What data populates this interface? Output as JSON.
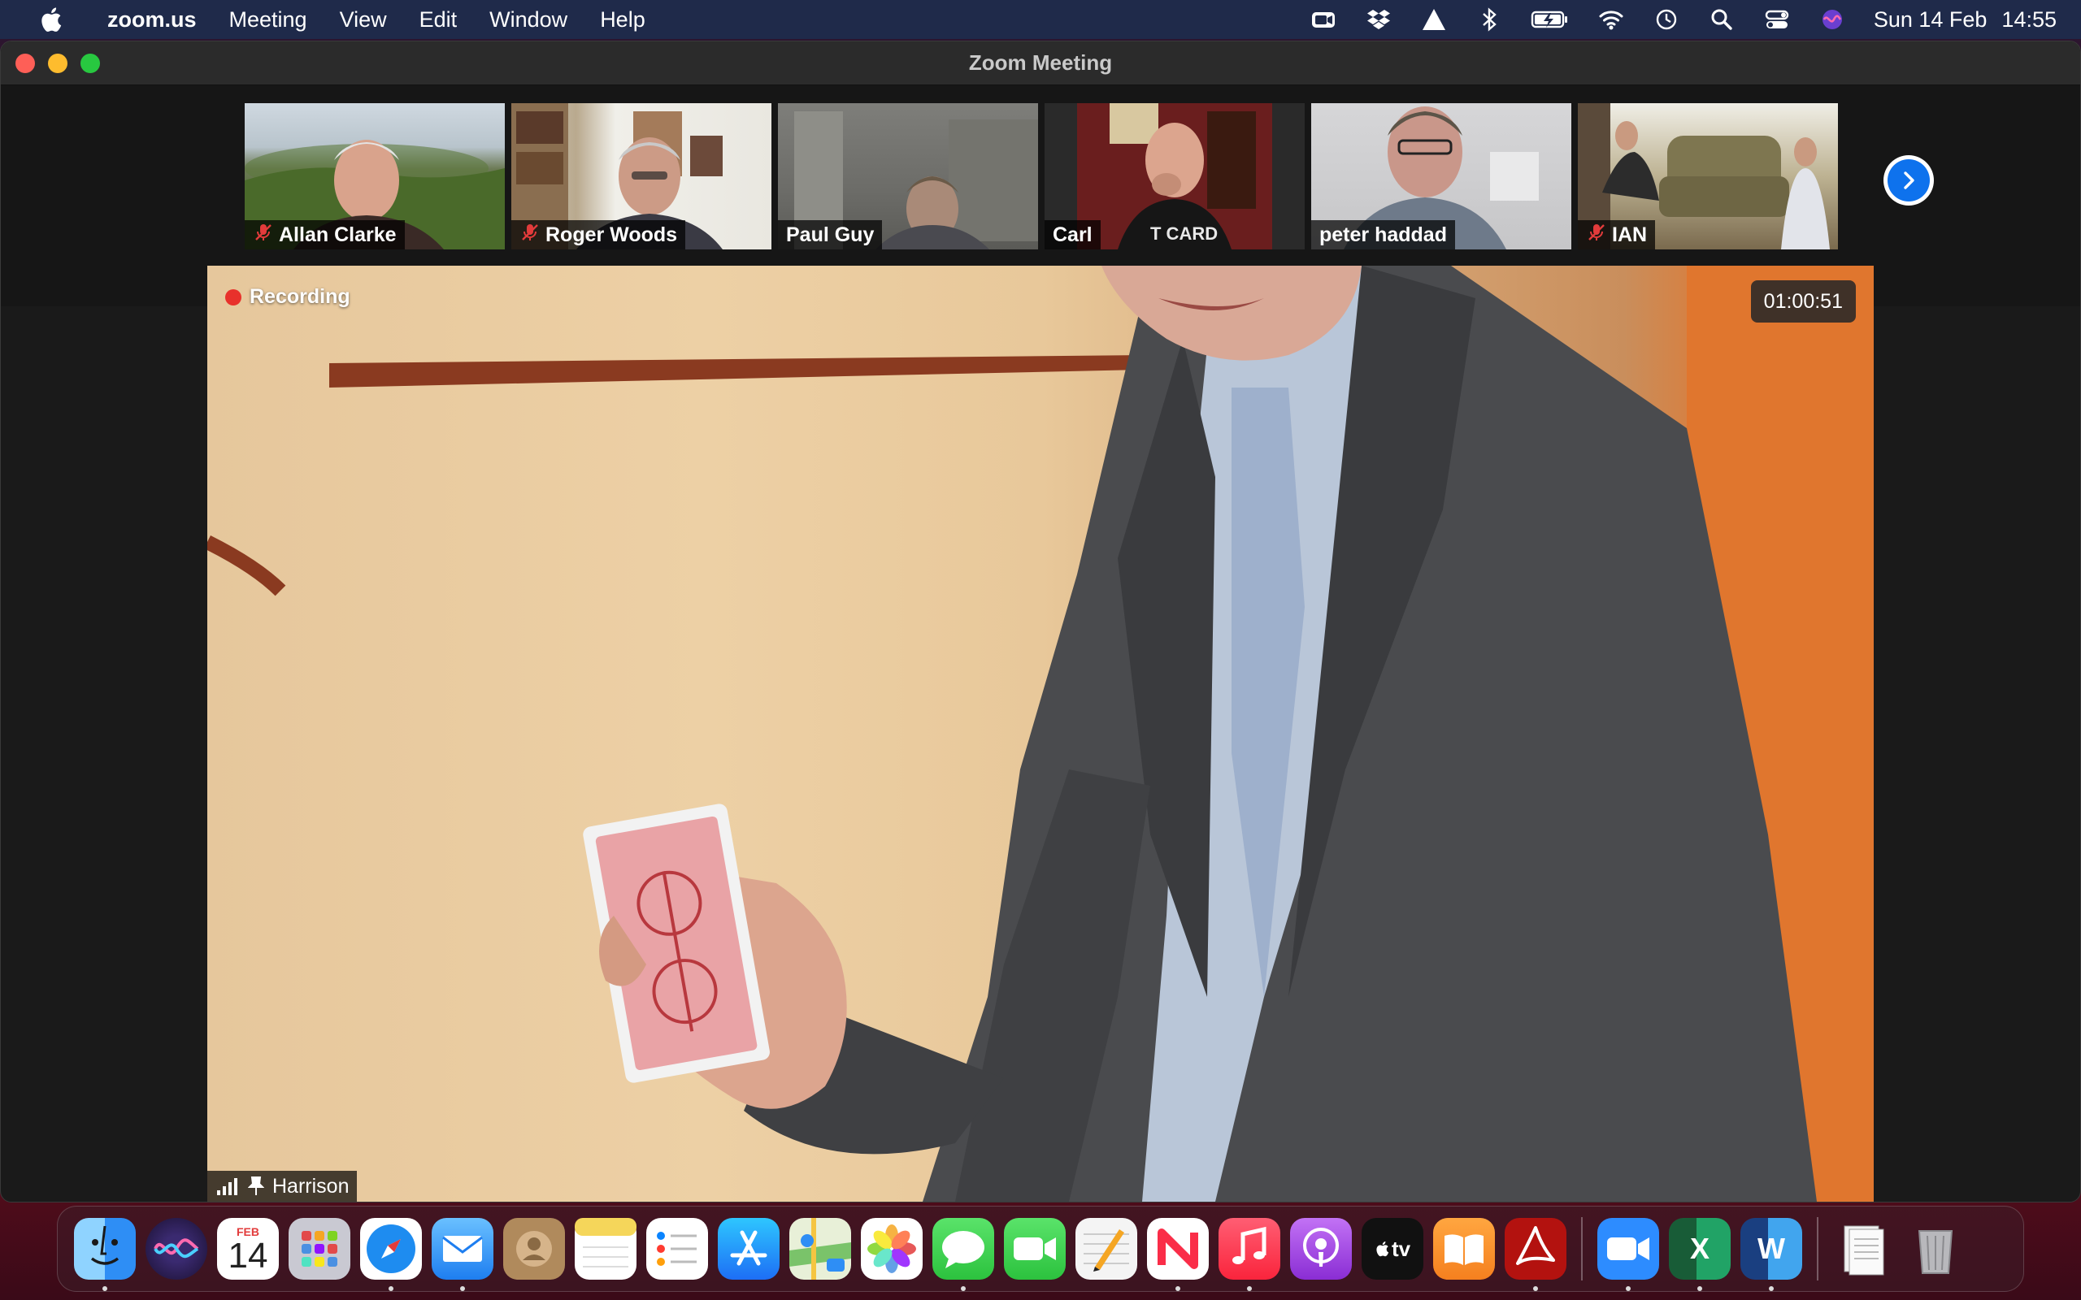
{
  "menubar": {
    "app_name": "zoom.us",
    "menus": [
      "Meeting",
      "View",
      "Edit",
      "Window",
      "Help"
    ],
    "date": "Sun 14 Feb",
    "time": "14:55",
    "status_icons": [
      "zoom-icon",
      "dropbox-icon",
      "drive-icon",
      "bluetooth-icon",
      "battery-icon",
      "wifi-icon",
      "time-machine-icon",
      "spotlight-search-icon",
      "control-center-icon",
      "siri-icon"
    ]
  },
  "window": {
    "title": "Zoom Meeting"
  },
  "participants": [
    {
      "name": "Allan Clarke",
      "muted": true
    },
    {
      "name": "Roger Woods",
      "muted": true
    },
    {
      "name": "Paul Guy",
      "muted": false
    },
    {
      "name": "Carl",
      "muted": false
    },
    {
      "name": "peter haddad",
      "muted": false
    },
    {
      "name": "IAN",
      "muted": true
    }
  ],
  "main_video": {
    "recording_label": "Recording",
    "elapsed": "01:00:51",
    "speaker_name": "Harrison"
  },
  "dock": {
    "apps": [
      {
        "name": "Finder",
        "icon": "finder-icon",
        "color": "#3a9cf0",
        "running": true
      },
      {
        "name": "Siri",
        "icon": "siri-icon",
        "color": "#5a3cc8",
        "running": false
      },
      {
        "name": "Calendar",
        "icon": "calendar-icon",
        "color": "#ffffff",
        "running": false,
        "month": "FEB",
        "day": "14"
      },
      {
        "name": "Launchpad",
        "icon": "launchpad-icon",
        "color": "#c9c9d2",
        "running": false
      },
      {
        "name": "Safari",
        "icon": "safari-icon",
        "color": "#1e8cf0",
        "running": true
      },
      {
        "name": "Mail",
        "icon": "mail-icon",
        "color": "#2e8ef5",
        "running": true
      },
      {
        "name": "Contacts",
        "icon": "contacts-icon",
        "color": "#b08a5c",
        "running": false
      },
      {
        "name": "Notes",
        "icon": "notes-icon",
        "color": "#f5d65a",
        "running": false
      },
      {
        "name": "Reminders",
        "icon": "reminders-icon",
        "color": "#ffffff",
        "running": false
      },
      {
        "name": "App Store",
        "icon": "app-store-icon",
        "color": "#1d8cf5",
        "running": false
      },
      {
        "name": "Maps",
        "icon": "maps-icon",
        "color": "#7ac36a",
        "running": false
      },
      {
        "name": "Photos",
        "icon": "photos-icon",
        "color": "#ffffff",
        "running": false
      },
      {
        "name": "Messages",
        "icon": "messages-icon",
        "color": "#3ccf4e",
        "running": true
      },
      {
        "name": "FaceTime",
        "icon": "facetime-icon",
        "color": "#3ccf4e",
        "running": false
      },
      {
        "name": "Pages",
        "icon": "pages-icon",
        "color": "#f4f4f4",
        "running": false
      },
      {
        "name": "News",
        "icon": "news-icon",
        "color": "#ffffff",
        "running": true
      },
      {
        "name": "Music",
        "icon": "music-icon",
        "color": "#fa3c55",
        "running": true
      },
      {
        "name": "Podcasts",
        "icon": "podcasts-icon",
        "color": "#a24ad9",
        "running": false
      },
      {
        "name": "TV",
        "icon": "tv-icon",
        "color": "#1a1a1a",
        "running": false
      },
      {
        "name": "Books",
        "icon": "books-icon",
        "color": "#f58a1f",
        "running": false
      },
      {
        "name": "Acrobat",
        "icon": "acrobat-icon",
        "color": "#b3120f",
        "running": true
      }
    ],
    "apps_right": [
      {
        "name": "Zoom",
        "icon": "zoom-app-icon",
        "color": "#2d8cff",
        "running": true
      },
      {
        "name": "Excel",
        "icon": "excel-icon",
        "color": "#1f7244",
        "running": true
      },
      {
        "name": "Word",
        "icon": "word-icon",
        "color": "#2b579a",
        "running": true
      }
    ],
    "apps_far_right": [
      {
        "name": "Documents",
        "icon": "documents-stack-icon",
        "color": "#e8e8e8",
        "running": false
      },
      {
        "name": "Trash",
        "icon": "trash-icon",
        "color": "#9a9a9a",
        "running": false
      }
    ],
    "tv_label": "tv",
    "excel_letter": "X",
    "word_letter": "W"
  }
}
